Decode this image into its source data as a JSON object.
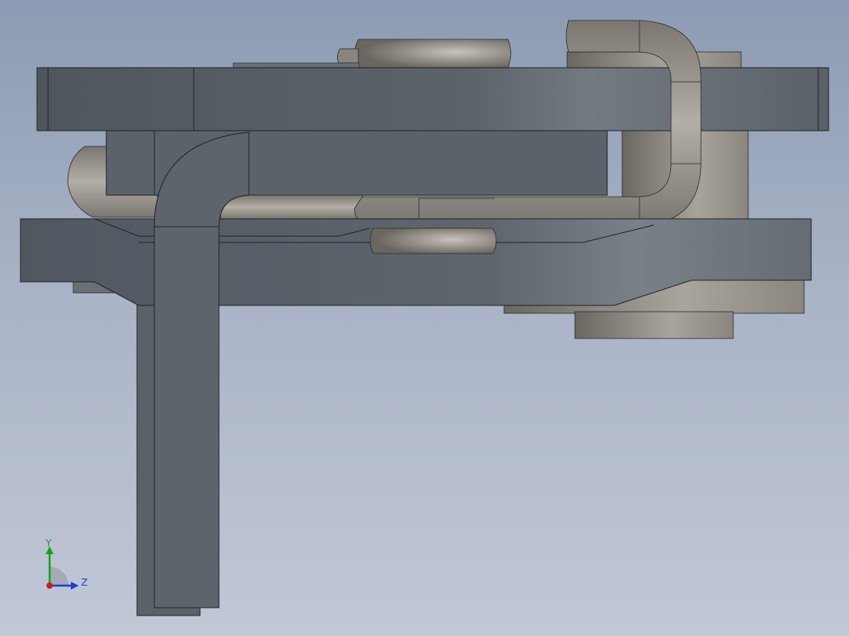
{
  "viewport": {
    "background_top": "#8c9bb3",
    "background_bottom": "#c1c8d6"
  },
  "model": {
    "palette": {
      "plate_dark": "#4e555d",
      "plate_mid": "#5d646c",
      "plate_light": "#737a82",
      "edge": "#1f2326",
      "pin_dark": "#6e6b66",
      "pin_mid": "#8e8a84",
      "pin_light": "#b8b3ab"
    }
  },
  "triad": {
    "y_label": "Y",
    "z_label": "Z",
    "y_color": "#19a019",
    "z_color": "#1e3cd2",
    "x_color": "#c81e1e"
  }
}
